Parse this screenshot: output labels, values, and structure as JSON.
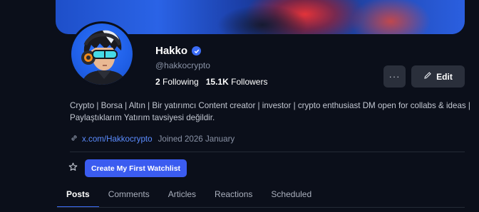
{
  "profile": {
    "name": "Hakko",
    "handle": "@hakkocrypto",
    "following_count": "2",
    "following_label": "Following",
    "followers_count": "15.1K",
    "followers_label": "Followers",
    "bio": "Crypto | Borsa | Altın | Bir yatırımcı Content creator | investor | crypto enthusiast DM open for collabs & ideas | Paylaştıklarım Yatırım tavsiyesi değildir.",
    "link": "x.com/Hakkocrypto",
    "joined": "Joined 2026 January"
  },
  "actions": {
    "more_label": "···",
    "edit_label": "Edit",
    "watchlist_label": "Create My First Watchlist"
  },
  "tabs": [
    {
      "label": "Posts",
      "active": true
    },
    {
      "label": "Comments",
      "active": false
    },
    {
      "label": "Articles",
      "active": false
    },
    {
      "label": "Reactions",
      "active": false
    },
    {
      "label": "Scheduled",
      "active": false
    }
  ],
  "colors": {
    "accent": "#3b5cf0",
    "verified": "#3b6cf6",
    "link": "#5b8cff",
    "background": "#0b0f1a"
  },
  "icons": {
    "verified": "verified-badge-icon",
    "edit": "pencil-icon",
    "link": "link-icon",
    "watchlist": "star-icon"
  }
}
